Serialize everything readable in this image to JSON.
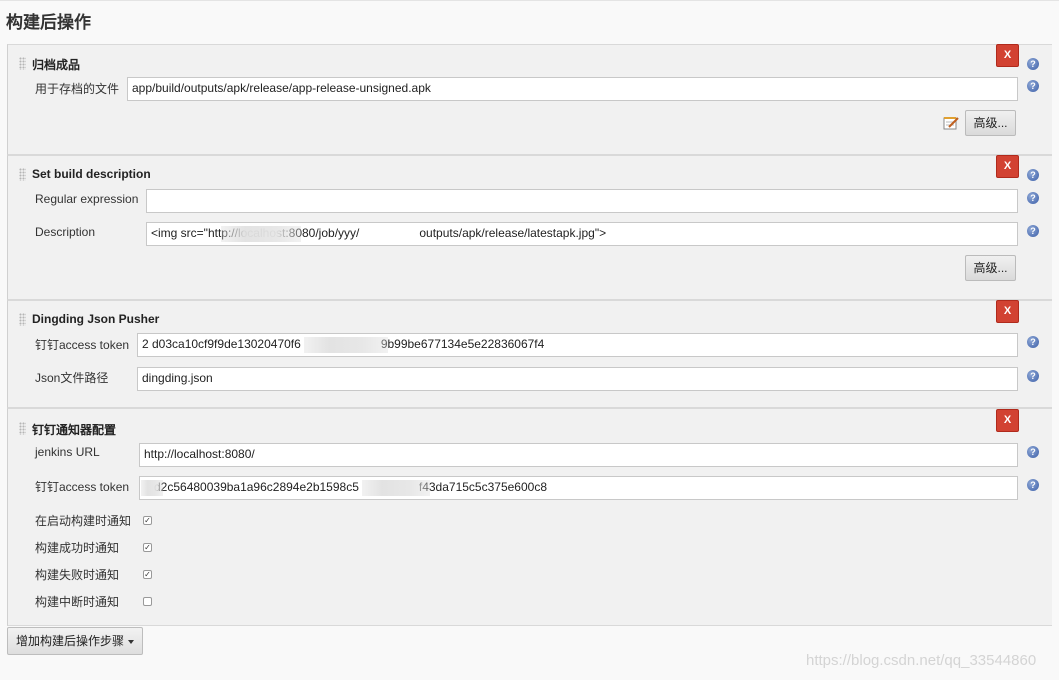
{
  "page": {
    "title": "构建后操作"
  },
  "sections": [
    {
      "title": "归档成品",
      "delete_label": "X",
      "fields": [
        {
          "label": "用于存档的文件",
          "value": "app/build/outputs/apk/release/app-release-unsigned.apk"
        }
      ],
      "advanced_label": "高级..."
    },
    {
      "title": "Set build description",
      "delete_label": "X",
      "fields": [
        {
          "label": "Regular expression",
          "value": ""
        },
        {
          "label": "Description",
          "value": "<img src=\"http://localhost:8080/job/yyy/",
          "value_tail": "outputs/apk/release/latestapk.jpg\">"
        }
      ],
      "advanced_label": "高级..."
    },
    {
      "title": "Dingding Json Pusher",
      "delete_label": "X",
      "fields": [
        {
          "label": "钉钉access token",
          "value": "2 d03ca10cf9f9de13020470f6",
          "value_tail": "9b99be677134e5e22836067f4"
        },
        {
          "label": "Json文件路径",
          "value": "dingding.json"
        }
      ]
    },
    {
      "title": "钉钉通知器配置",
      "delete_label": "X",
      "fields": [
        {
          "label": "jenkins URL",
          "value": "http://localhost:8080/"
        },
        {
          "label": "钉钉access token",
          "value": "d2c56480039ba1a96c2894e2b1598c5",
          "value_tail": "f43da715c5c375e600c8"
        }
      ],
      "checkboxes": [
        {
          "label": "在启动构建时通知",
          "checked": true
        },
        {
          "label": "构建成功时通知",
          "checked": true
        },
        {
          "label": "构建失败时通知",
          "checked": true
        },
        {
          "label": "构建中断时通知",
          "checked": false
        }
      ]
    }
  ],
  "help_glyph": "?",
  "add_step_label": "增加构建后操作步骤",
  "watermark": "https://blog.csdn.net/qq_33544860",
  "icons": [
    "drag-handle-icon",
    "help-icon",
    "notepad-edit-icon",
    "dropdown-caret-icon",
    "checkmark-icon"
  ],
  "colors": {
    "delete": "#d24232",
    "help": "#3c5fa8",
    "section_bg": "#f1f1f1"
  }
}
